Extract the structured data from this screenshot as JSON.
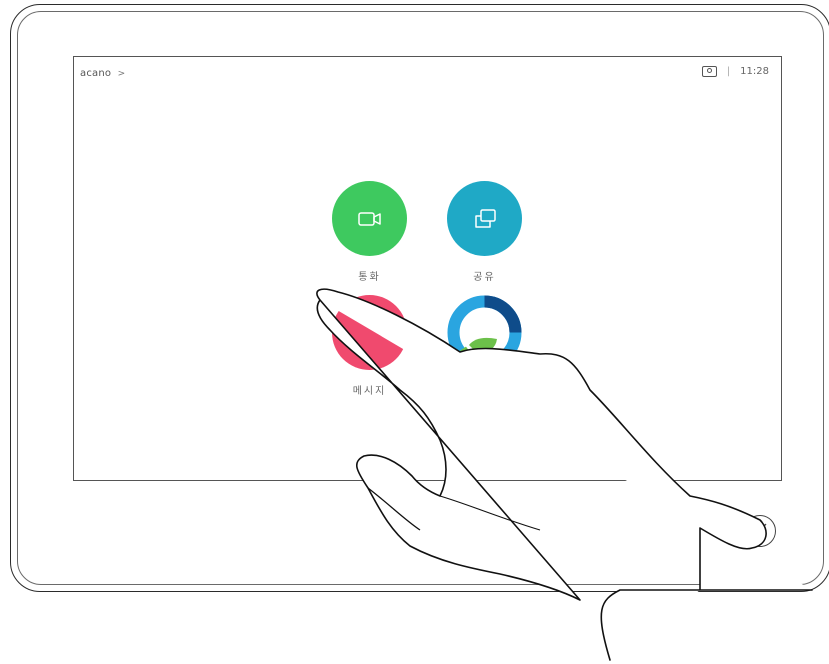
{
  "header": {
    "brand": "acano",
    "brand_chevron": ">",
    "separator": "|",
    "time": "11:28",
    "selfview_icon": "selfview-icon"
  },
  "apps": [
    {
      "id": "call",
      "label": "통화",
      "color": "#3ec95f",
      "icon": "video-camera-icon"
    },
    {
      "id": "share",
      "label": "공유",
      "color": "#1fa9c6",
      "icon": "share-screen-icon"
    },
    {
      "id": "messaging",
      "label": "메시지",
      "color": "#f04a6e",
      "icon": "message-icon"
    },
    {
      "id": "webex",
      "label": "",
      "color": "#2196d1",
      "icon": "webex-logo-icon"
    }
  ],
  "controls": {
    "mute_icon": "microphone-muted-icon"
  },
  "overlay": {
    "hand_icon": "pointing-hand"
  }
}
